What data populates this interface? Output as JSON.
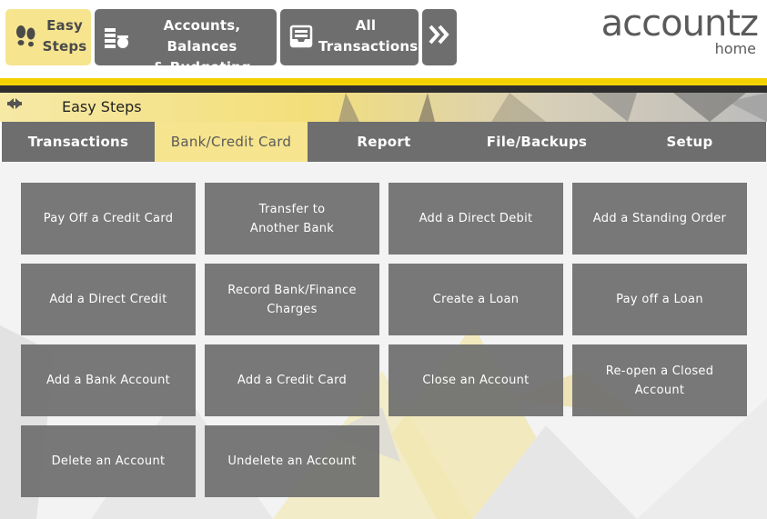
{
  "topnav": {
    "easy_steps": "Easy\nSteps",
    "accounts": "Accounts, Balances\n& Budgeting",
    "all_transactions": "All\nTransactions",
    "more": "»"
  },
  "logo": {
    "name": "accountz",
    "sub": "home"
  },
  "breadcrumb": {
    "back": "🡄",
    "forward": "🡆",
    "title": "Easy Steps"
  },
  "tabs": [
    {
      "label": "Transactions"
    },
    {
      "label": "Bank/Credit Card"
    },
    {
      "label": "Report"
    },
    {
      "label": "File/Backups"
    },
    {
      "label": "Setup"
    }
  ],
  "actions": [
    {
      "label": "Pay Off a Credit Card"
    },
    {
      "label": "Transfer to\nAnother Bank"
    },
    {
      "label": "Add a Direct Debit"
    },
    {
      "label": "Add a Standing Order"
    },
    {
      "label": "Add a Direct Credit"
    },
    {
      "label": "Record Bank/Finance\nCharges"
    },
    {
      "label": "Create a Loan"
    },
    {
      "label": "Pay off a Loan"
    },
    {
      "label": "Add a Bank Account"
    },
    {
      "label": "Add a Credit Card"
    },
    {
      "label": "Close an Account"
    },
    {
      "label": "Re-open a Closed Account"
    },
    {
      "label": "Delete an Account"
    },
    {
      "label": "Undelete an Account"
    }
  ],
  "colors": {
    "accent_yellow": "#f2d200",
    "button_gray": "#6e6e6e",
    "active_tab": "#f6e48e"
  }
}
